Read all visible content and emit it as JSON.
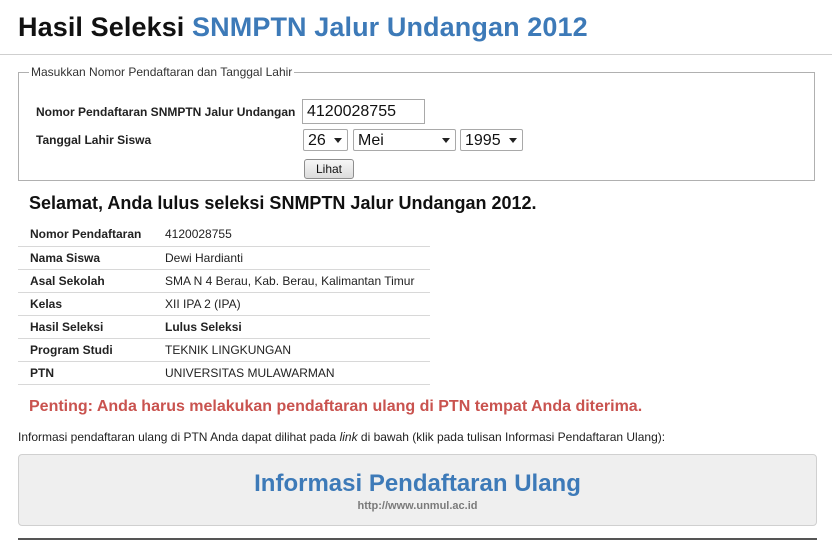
{
  "header": {
    "title_part1": "Hasil Seleksi",
    "title_part2": "SNMPTN Jalur Undangan 2012"
  },
  "form": {
    "legend": "Masukkan Nomor Pendaftaran dan Tanggal Lahir",
    "nomor_label": "Nomor Pendaftaran SNMPTN Jalur Undangan",
    "nomor_value": "4120028755",
    "tanggal_label": "Tanggal Lahir Siswa",
    "day": "26",
    "month": "Mei",
    "year": "1995",
    "submit_label": "Lihat"
  },
  "result": {
    "headline": "Selamat, Anda lulus seleksi SNMPTN Jalur Undangan 2012.",
    "rows": [
      {
        "label": "Nomor Pendaftaran",
        "value": "4120028755"
      },
      {
        "label": "Nama Siswa",
        "value": "Dewi Hardianti"
      },
      {
        "label": "Asal Sekolah",
        "value": "SMA N 4 Berau, Kab. Berau, Kalimantan Timur"
      },
      {
        "label": "Kelas",
        "value": "XII IPA 2 (IPA)"
      },
      {
        "label": "Hasil Seleksi",
        "value": "Lulus Seleksi"
      },
      {
        "label": "Program Studi",
        "value": "TEKNIK LINGKUNGAN"
      },
      {
        "label": "PTN",
        "value": "UNIVERSITAS MULAWARMAN"
      }
    ]
  },
  "notice": {
    "penting": "Penting: Anda harus melakukan pendaftaran ulang di PTN tempat Anda diterima.",
    "info_before": "Informasi pendaftaran ulang di PTN Anda dapat dilihat pada ",
    "info_link_word": "link",
    "info_after": " di bawah (klik pada tulisan Informasi Pendaftaran Ulang):"
  },
  "daftar_ulang": {
    "title": "Informasi Pendaftaran Ulang",
    "url": "http://www.unmul.ac.id"
  },
  "colors": {
    "brand_blue": "#3d7ab8",
    "warning_red": "#c9534f"
  }
}
